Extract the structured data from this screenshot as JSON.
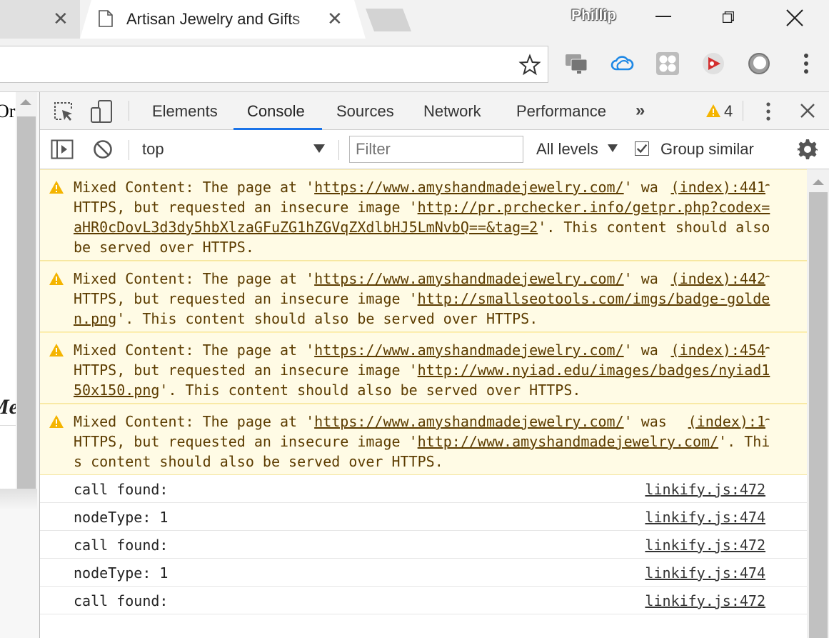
{
  "browser": {
    "active_tab_title": "Artisan Jewelry and Gifts",
    "profile_name": "Phillip"
  },
  "page": {
    "text_fragment_1": "Or",
    "text_fragment_2": "Me"
  },
  "devtools": {
    "tabs": [
      "Elements",
      "Console",
      "Sources",
      "Network",
      "Performance"
    ],
    "active_tab": "Console",
    "warning_count": "4",
    "context": "top",
    "filter_placeholder": "Filter",
    "levels": "All levels",
    "group_similar_label": "Group similar",
    "group_similar_checked": true
  },
  "console": {
    "messages": [
      {
        "level": "warning",
        "prefix": "Mixed Content: The page at '",
        "page_url": "https://www.amyshandmadejewelry.com/",
        "middle": "' was loaded over HTTPS, but requested an insecure image '",
        "resource_url": "http://pr.prchecker.info/getpr.php?codex=aHR0cDovL3d3dy5hbXlzaGFuZG1hZGVqZXdlbHJ5LmNvbQ==&tag=2",
        "suffix": "'. This content should also be served over HTTPS.",
        "source": "(index):441"
      },
      {
        "level": "warning",
        "prefix": "Mixed Content: The page at '",
        "page_url": "https://www.amyshandmadejewelry.com/",
        "middle": "' was loaded over HTTPS, but requested an insecure image '",
        "resource_url": "http://smallseotools.com/imgs/badge-golden.png",
        "suffix": "'. This content should also be served over HTTPS.",
        "source": "(index):442"
      },
      {
        "level": "warning",
        "prefix": "Mixed Content: The page at '",
        "page_url": "https://www.amyshandmadejewelry.com/",
        "middle": "' was loaded over HTTPS, but requested an insecure image '",
        "resource_url": "http://www.nyiad.edu/images/badges/nyiad150x150.png",
        "suffix": "'. This content should also be served over HTTPS.",
        "source": "(index):454"
      },
      {
        "level": "warning",
        "prefix": "Mixed Content: The page at '",
        "page_url": "https://www.amyshandmadejewelry.com/",
        "middle": "' was loaded over HTTPS, but requested an insecure image '",
        "resource_url": "http://www.amyshandmadejewelry.com/",
        "suffix": "'. This content should also be served over HTTPS.",
        "source": "(index):1"
      },
      {
        "level": "log",
        "text": "call found:",
        "source": "linkify.js:472"
      },
      {
        "level": "log",
        "text": "nodeType: 1",
        "source": "linkify.js:474"
      },
      {
        "level": "log",
        "text": "call found:",
        "source": "linkify.js:472"
      },
      {
        "level": "log",
        "text": "nodeType: 1",
        "source": "linkify.js:474"
      },
      {
        "level": "log",
        "text": "call found:",
        "source": "linkify.js:472"
      }
    ]
  },
  "colors": {
    "accent": "#1a73e8",
    "warning_bg": "#fffbe5",
    "warning_icon": "#f4b400",
    "warning_text": "#5c3c00"
  },
  "icons": {
    "close_tab": "close-icon",
    "page": "document-icon",
    "bookmark": "star-icon",
    "warning": "warning-icon"
  }
}
